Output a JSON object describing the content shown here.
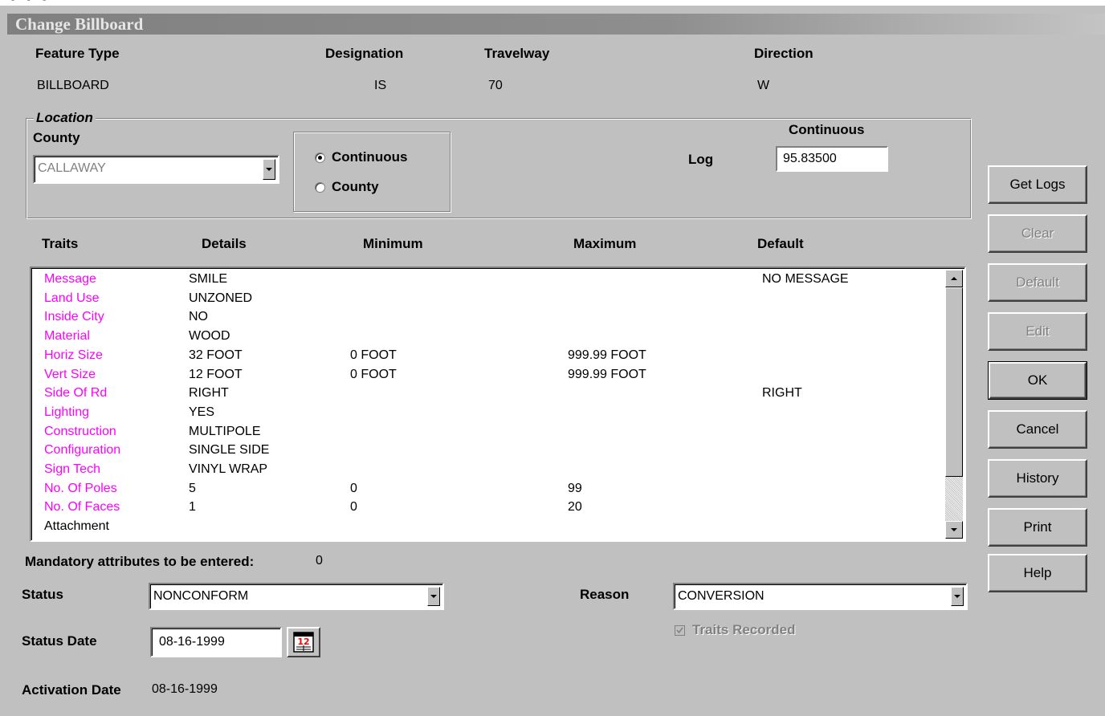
{
  "window": {
    "title": "Change Billboard"
  },
  "header": {
    "feature_type_label": "Feature Type",
    "feature_type_value": "BILLBOARD",
    "designation_label": "Designation",
    "designation_value": "IS",
    "travelway_label": "Travelway",
    "travelway_value": "70",
    "direction_label": "Direction",
    "direction_value": "W"
  },
  "location": {
    "legend": "Location",
    "county_label": "County",
    "county_value": "CALLAWAY",
    "radio_continuous": "Continuous",
    "radio_county": "County",
    "selected_radio": "Continuous",
    "continuous_header": "Continuous",
    "log_label": "Log",
    "log_value": "95.83500"
  },
  "traits": {
    "headers": {
      "traits": "Traits",
      "details": "Details",
      "minimum": "Minimum",
      "maximum": "Maximum",
      "default": "Default"
    },
    "rows": [
      {
        "trait": "Message",
        "details": "SMILE",
        "minimum": "",
        "maximum": "",
        "default": "NO MESSAGE",
        "mandatory": true
      },
      {
        "trait": "Land Use",
        "details": "UNZONED",
        "minimum": "",
        "maximum": "",
        "default": "",
        "mandatory": true
      },
      {
        "trait": "Inside City",
        "details": "NO",
        "minimum": "",
        "maximum": "",
        "default": "",
        "mandatory": true
      },
      {
        "trait": "Material",
        "details": "WOOD",
        "minimum": "",
        "maximum": "",
        "default": "",
        "mandatory": true
      },
      {
        "trait": "Horiz Size",
        "details": "32 FOOT",
        "minimum": "0 FOOT",
        "maximum": "999.99 FOOT",
        "default": "",
        "mandatory": true
      },
      {
        "trait": "Vert Size",
        "details": "12 FOOT",
        "minimum": "0 FOOT",
        "maximum": "999.99 FOOT",
        "default": "",
        "mandatory": true
      },
      {
        "trait": "Side Of Rd",
        "details": "RIGHT",
        "minimum": "",
        "maximum": "",
        "default": "RIGHT",
        "mandatory": true
      },
      {
        "trait": "Lighting",
        "details": "YES",
        "minimum": "",
        "maximum": "",
        "default": "",
        "mandatory": true
      },
      {
        "trait": "Construction",
        "details": "MULTIPOLE",
        "minimum": "",
        "maximum": "",
        "default": "",
        "mandatory": true
      },
      {
        "trait": "Configuration",
        "details": "SINGLE SIDE",
        "minimum": "",
        "maximum": "",
        "default": "",
        "mandatory": true
      },
      {
        "trait": "Sign Tech",
        "details": "VINYL WRAP",
        "minimum": "",
        "maximum": "",
        "default": "",
        "mandatory": true
      },
      {
        "trait": "No. Of Poles",
        "details": "5",
        "minimum": "0",
        "maximum": "99",
        "default": "",
        "mandatory": true
      },
      {
        "trait": "No. Of Faces",
        "details": "1",
        "minimum": "0",
        "maximum": "20",
        "default": "",
        "mandatory": true
      },
      {
        "trait": "Attachment",
        "details": "",
        "minimum": "",
        "maximum": "",
        "default": "",
        "mandatory": false
      }
    ]
  },
  "mandatory": {
    "label": "Mandatory attributes to be entered:",
    "count": "0"
  },
  "status": {
    "label": "Status",
    "value": "NONCONFORM"
  },
  "reason": {
    "label": "Reason",
    "value": "CONVERSION"
  },
  "traits_recorded": {
    "label": "Traits Recorded",
    "checked": true,
    "enabled": false
  },
  "status_date": {
    "label": "Status Date",
    "value": "08-16-1999",
    "calendar_glyph": "12"
  },
  "activation_date": {
    "label": "Activation Date",
    "value": "08-16-1999"
  },
  "buttons": {
    "get_logs": "Get Logs",
    "clear": "Clear",
    "default": "Default",
    "edit": "Edit",
    "ok": "OK",
    "cancel": "Cancel",
    "history": "History",
    "print": "Print",
    "help": "Help"
  },
  "colors": {
    "mandatory_trait": "#ff00ff",
    "disabled_text": "#808080",
    "window_bg": "#c0c0c0"
  }
}
